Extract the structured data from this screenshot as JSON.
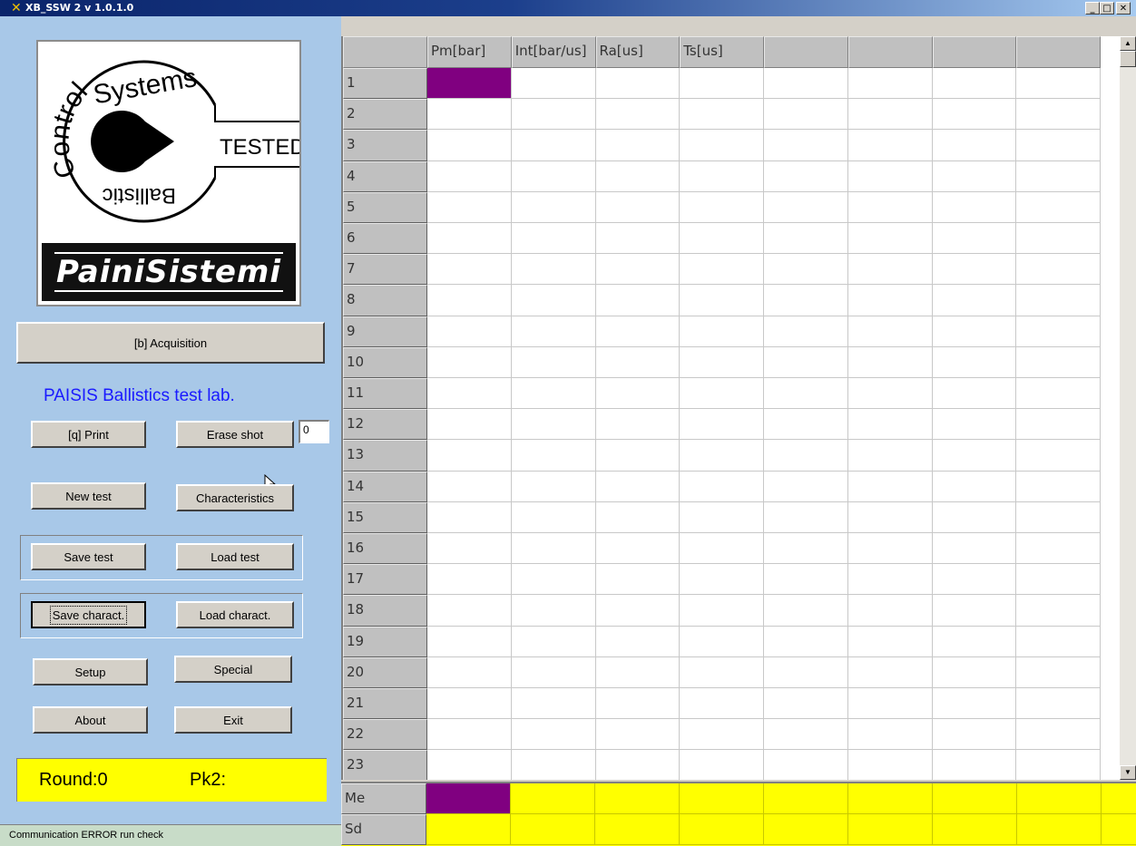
{
  "window": {
    "title": "XB_SSW 2  v 1.0.1.0",
    "minimize": "_",
    "maximize": "□",
    "close": "✕"
  },
  "logo": {
    "ring_top": "Systems",
    "ring_left": "Control",
    "ring_bottom": "Ballistic",
    "tested": "TESTED",
    "brand": "PainiSistemi"
  },
  "buttons": {
    "acquisition": "[b] Acquisition",
    "print": "[q] Print",
    "erase_shot": "Erase shot",
    "new_test": "New test",
    "characteristics": "Characteristics",
    "save_test": "Save test",
    "load_test": "Load test",
    "save_charact": "Save charact.",
    "load_charact": "Load charact.",
    "setup": "Setup",
    "special": "Special",
    "about": "About",
    "exit": "Exit"
  },
  "lab_title": "PAISIS Ballistics test lab.",
  "erase_shot_value": "0",
  "round_label": "Round:0",
  "pk2_label": "Pk2:",
  "status_text": "Communication ERROR run check",
  "grid": {
    "columns": [
      "Pm[bar]",
      "Int[bar/us]",
      "Ra[us]",
      "Ts[us]",
      "",
      "",
      "",
      ""
    ],
    "rows": [
      "1",
      "2",
      "3",
      "4",
      "5",
      "6",
      "7",
      "8",
      "9",
      "10",
      "11",
      "12",
      "13",
      "14",
      "15",
      "16",
      "17",
      "18",
      "19",
      "20",
      "21",
      "22",
      "23"
    ],
    "selected_color": "#800080"
  },
  "stats": {
    "rows": [
      "Me",
      "Sd"
    ],
    "fill_color": "#ffff00"
  }
}
